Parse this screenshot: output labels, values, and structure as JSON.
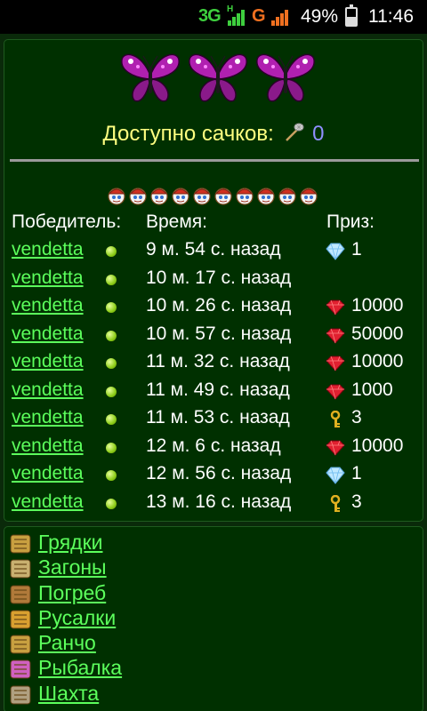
{
  "status_bar": {
    "network": "3G",
    "network_sub": "H",
    "network2": "G",
    "battery": "49%",
    "battery_level": 0.49,
    "time": "11:46"
  },
  "header": {
    "nets_label": "Доступно сачков:",
    "nets_value": "0",
    "butterfly_icons": [
      "butterfly-icon",
      "butterfly-icon",
      "butterfly-icon"
    ],
    "ticket_count": 10
  },
  "table": {
    "col_winner": "Победитель:",
    "col_time": "Время:",
    "col_prize": "Приз:",
    "rows": [
      {
        "winner": "vendetta",
        "time": "9 м. 54 с. назад",
        "prize_icon": "diamond-icon",
        "prize": "1"
      },
      {
        "winner": "vendetta",
        "time": "10 м. 17 с. назад",
        "prize_icon": "",
        "prize": ""
      },
      {
        "winner": "vendetta",
        "time": "10 м. 26 с. назад",
        "prize_icon": "ruby-icon",
        "prize": "10000"
      },
      {
        "winner": "vendetta",
        "time": "10 м. 57 с. назад",
        "prize_icon": "ruby-icon",
        "prize": "50000"
      },
      {
        "winner": "vendetta",
        "time": "11 м. 32 с. назад",
        "prize_icon": "ruby-icon",
        "prize": "10000"
      },
      {
        "winner": "vendetta",
        "time": "11 м. 49 с. назад",
        "prize_icon": "ruby-icon",
        "prize": "1000"
      },
      {
        "winner": "vendetta",
        "time": "11 м. 53 с. назад",
        "prize_icon": "key-icon",
        "prize": "3"
      },
      {
        "winner": "vendetta",
        "time": "12 м. 6 с. назад",
        "prize_icon": "ruby-icon",
        "prize": "10000"
      },
      {
        "winner": "vendetta",
        "time": "12 м. 56 с. назад",
        "prize_icon": "diamond-icon",
        "prize": "1"
      },
      {
        "winner": "vendetta",
        "time": "13 м. 16 с. назад",
        "prize_icon": "key-icon",
        "prize": "3"
      }
    ]
  },
  "menu": {
    "items": [
      {
        "label": "Грядки",
        "icon": "garden-bed-icon",
        "color": "#c8a040"
      },
      {
        "label": "Загоны",
        "icon": "pen-icon",
        "color": "#c8b070"
      },
      {
        "label": "Погреб",
        "icon": "cellar-icon",
        "color": "#b07a3a"
      },
      {
        "label": "Русалки",
        "icon": "mermaid-icon",
        "color": "#d8a030"
      },
      {
        "label": "Ранчо",
        "icon": "ranch-icon",
        "color": "#c8a040"
      },
      {
        "label": "Рыбалка",
        "icon": "fishing-icon",
        "color": "#d060c0"
      },
      {
        "label": "Шахта",
        "icon": "mine-icon",
        "color": "#b0a080"
      }
    ]
  },
  "colors": {
    "background": "#003000",
    "link": "#5cff5c",
    "nets_text": "#ffff80",
    "nets_value": "#9090ff"
  }
}
